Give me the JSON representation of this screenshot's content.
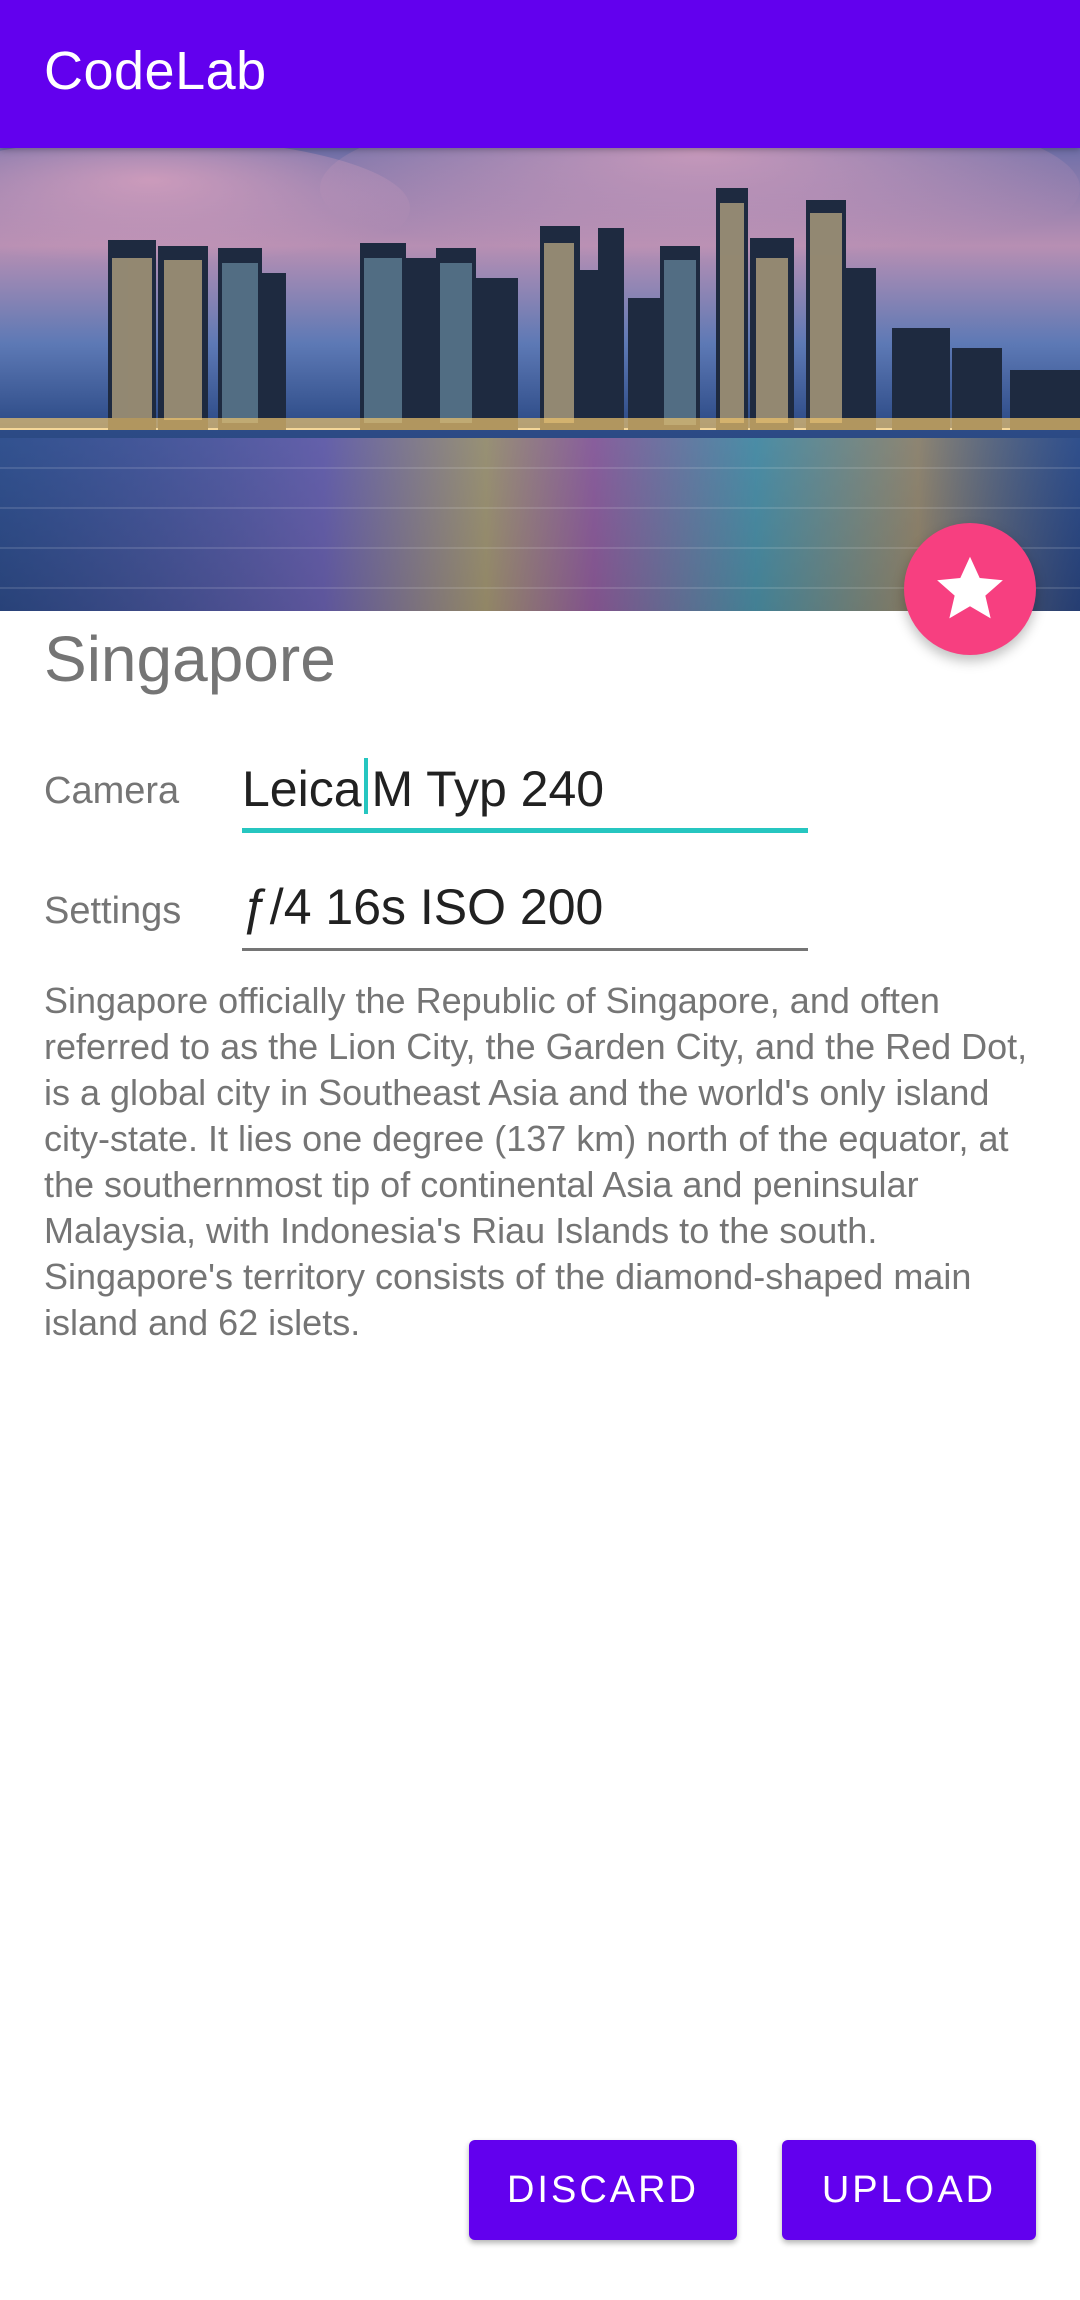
{
  "app_bar": {
    "title": "CodeLab",
    "color": "#6200ee"
  },
  "hero": {
    "image": "singapore-skyline-night-photo",
    "favorite_icon": "star-icon",
    "fab_color": "#f73f80"
  },
  "photo": {
    "title": "Singapore",
    "fields": [
      {
        "label": "Camera",
        "value_before_caret": "Leica",
        "value_after_caret": "M Typ 240",
        "focused": true
      },
      {
        "label": "Settings",
        "value": "ƒ/4 16s ISO 200",
        "focused": false
      }
    ],
    "description": "Singapore officially the Republic of Singapore, and often referred to as the Lion City, the Garden City, and the Red Dot, is a global city in Southeast Asia and the world's only island city-state. It lies one degree (137 km) north of the equator, at the southernmost tip of continental Asia and peninsular Malaysia, with Indonesia's Riau Islands to the south. Singapore's territory consists of the diamond-shaped main island and 62 islets."
  },
  "actions": {
    "discard_label": "DISCARD",
    "upload_label": "UPLOAD"
  },
  "colors": {
    "accent": "#26c6c0",
    "text_secondary": "#757575"
  }
}
